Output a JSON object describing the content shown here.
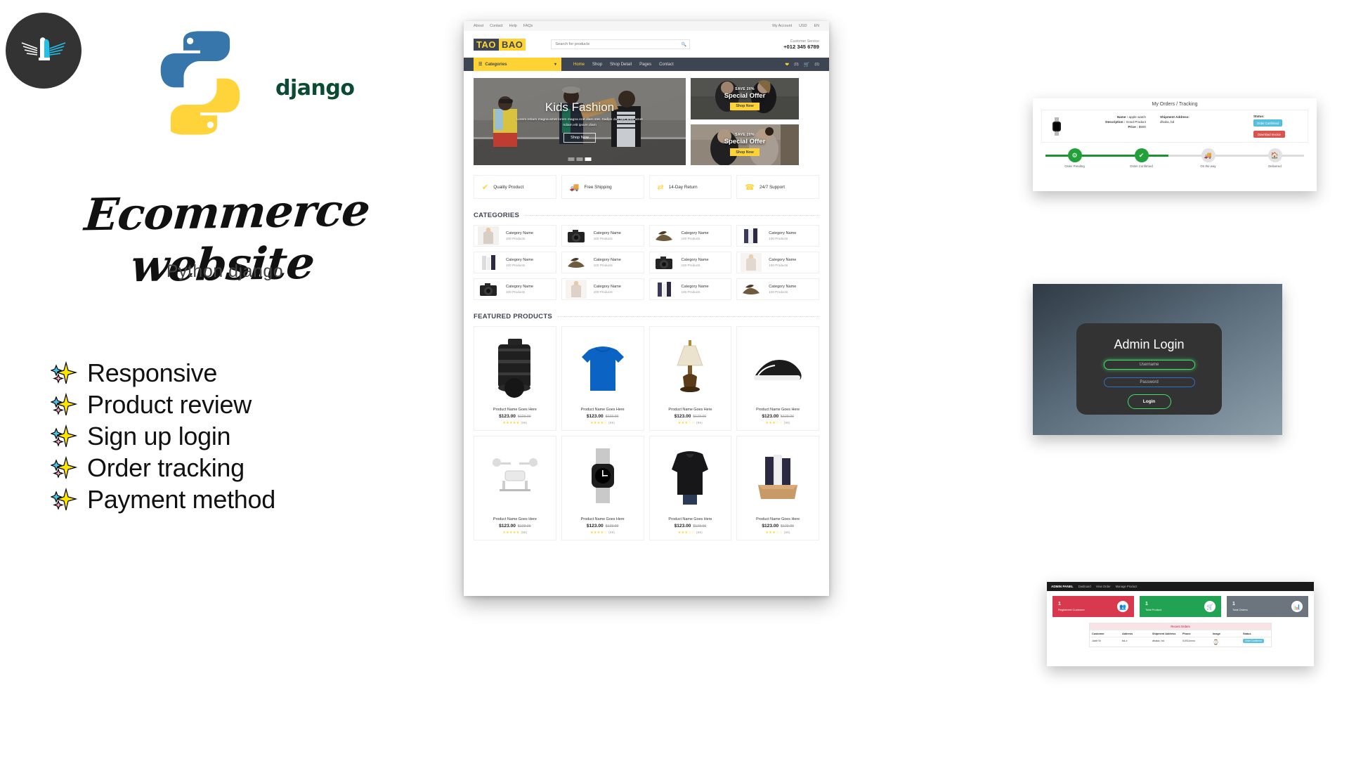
{
  "left": {
    "logo_alt": "bird-wing-logo",
    "python_logo_alt": "python-logo",
    "django_wordmark": "django",
    "headline": "Ecommerce website",
    "subhead": "Python django",
    "features": [
      {
        "icon": "sparkles-icon",
        "label": "Responsive"
      },
      {
        "icon": "sparkles-icon",
        "label": "Product review"
      },
      {
        "icon": "sparkles-icon",
        "label": "Sign up login"
      },
      {
        "icon": "sparkles-icon",
        "label": "Order tracking"
      },
      {
        "icon": "sparkles-icon",
        "label": "Payment method"
      }
    ]
  },
  "storefront": {
    "topbar": {
      "links": [
        "About",
        "Contact",
        "Help",
        "FAQs"
      ],
      "account": "My Account",
      "currency": "USD",
      "language": "EN"
    },
    "header": {
      "logo_first": "TAO",
      "logo_second": "BAO",
      "search_placeholder": "Search for products",
      "customer_service_label": "Customer Service",
      "phone": "+012 345 6789"
    },
    "nav": {
      "categories_label": "Categories",
      "links": [
        "Home",
        "Shop",
        "Shop Detail",
        "Pages",
        "Contact"
      ],
      "wishlist_count": "(0)",
      "cart_count": "(0)"
    },
    "hero": {
      "title": "Kids Fashion",
      "subtitle": "Lorem rebum magna amet lorem magna erat diam stet. Sadips duo stet amet amet ndiam elit ipsum diam",
      "button": "Shop Now",
      "dots": 3,
      "active_dot": 3
    },
    "promos": [
      {
        "save": "SAVE 20%",
        "title": "Special Offer",
        "button": "Shop Now"
      },
      {
        "save": "SAVE 20%",
        "title": "Special Offer",
        "button": "Shop Now"
      }
    ],
    "features": [
      {
        "icon": "check-icon",
        "label": "Quality Product"
      },
      {
        "icon": "truck-icon",
        "label": "Free Shipping"
      },
      {
        "icon": "exchange-icon",
        "label": "14-Day Return"
      },
      {
        "icon": "phone-icon",
        "label": "24/7 Support"
      }
    ],
    "categories_heading": "CATEGORIES",
    "categories": [
      {
        "name": "Category Name",
        "count": "100 Products",
        "thumb": "blouse"
      },
      {
        "name": "Category Name",
        "count": "100 Products",
        "thumb": "camera"
      },
      {
        "name": "Category Name",
        "count": "100 Products",
        "thumb": "shoes"
      },
      {
        "name": "Category Name",
        "count": "100 Products",
        "thumb": "cosmetics"
      },
      {
        "name": "Category Name",
        "count": "100 Products",
        "thumb": "cosmetics"
      },
      {
        "name": "Category Name",
        "count": "100 Products",
        "thumb": "shoes"
      },
      {
        "name": "Category Name",
        "count": "100 Products",
        "thumb": "camera"
      },
      {
        "name": "Category Name",
        "count": "100 Products",
        "thumb": "blouse"
      },
      {
        "name": "Category Name",
        "count": "100 Products",
        "thumb": "camera"
      },
      {
        "name": "Category Name",
        "count": "100 Products",
        "thumb": "blouse"
      },
      {
        "name": "Category Name",
        "count": "100 Products",
        "thumb": "cosmetics"
      },
      {
        "name": "Category Name",
        "count": "100 Products",
        "thumb": "shoes"
      }
    ],
    "featured_heading": "FEATURED PRODUCTS",
    "products": [
      {
        "name": "Product Name Goes Here",
        "price": "$123.00",
        "old_price": "$123.00",
        "stars": 5,
        "reviews": "(99)",
        "thumb": "camera"
      },
      {
        "name": "Product Name Goes Here",
        "price": "$123.00",
        "old_price": "$123.00",
        "stars": 4.5,
        "reviews": "(99)",
        "thumb": "sweater"
      },
      {
        "name": "Product Name Goes Here",
        "price": "$123.00",
        "old_price": "$123.00",
        "stars": 3.5,
        "reviews": "(99)",
        "thumb": "lamp"
      },
      {
        "name": "Product Name Goes Here",
        "price": "$123.00",
        "old_price": "$123.00",
        "stars": 3.5,
        "reviews": "(99)",
        "thumb": "sneaker"
      },
      {
        "name": "Product Name Goes Here",
        "price": "$123.00",
        "old_price": "$123.00",
        "stars": 5,
        "reviews": "(99)",
        "thumb": "drone"
      },
      {
        "name": "Product Name Goes Here",
        "price": "$123.00",
        "old_price": "$123.00",
        "stars": 4.5,
        "reviews": "(99)",
        "thumb": "watch"
      },
      {
        "name": "Product Name Goes Here",
        "price": "$123.00",
        "old_price": "$123.00",
        "stars": 3.5,
        "reviews": "(99)",
        "thumb": "blouse"
      },
      {
        "name": "Product Name Goes Here",
        "price": "$123.00",
        "old_price": "$123.00",
        "stars": 3.5,
        "reviews": "(99)",
        "thumb": "cosmetics"
      }
    ]
  },
  "tracking": {
    "title": "My Orders / Tracking",
    "name_label": "Name :",
    "name_value": "apple watch",
    "desc_label": "Description :",
    "desc_value": "Good Product",
    "price_label": "Price :",
    "price_value": "$500",
    "shipment_label": "Shipment Address:",
    "shipment_value": "dhaka, bd",
    "status_label": "Status:",
    "status_badge": "Order Confirmed",
    "invoice_button": "Download Invoice",
    "steps": [
      {
        "label": "Order Pending",
        "icon": "gear-icon",
        "done": true
      },
      {
        "label": "Order Confirmed",
        "icon": "check-icon",
        "done": true
      },
      {
        "label": "On the way",
        "icon": "truck-icon",
        "done": false
      },
      {
        "label": "Delivered",
        "icon": "home-icon",
        "done": false
      }
    ]
  },
  "login": {
    "title": "Admin Login",
    "username_placeholder": "Username",
    "password_placeholder": "Password",
    "button": "Login"
  },
  "dashboard": {
    "brand": "ADMIN PANEL",
    "nav": [
      "Dasboard",
      "View Order",
      "Manage Product"
    ],
    "cards": [
      {
        "num": "1",
        "caption": "Registered Customer",
        "color": "#d9394f",
        "icon": "users-icon"
      },
      {
        "num": "1",
        "caption": "Total Product",
        "color": "#21a353",
        "icon": "cart-icon"
      },
      {
        "num": "1",
        "caption": "Total Orders",
        "color": "#6c757d",
        "icon": "chart-icon"
      }
    ],
    "table": {
      "title": "Recent Orders",
      "headers": [
        "Customer",
        "Address",
        "Shipment Address",
        "Phone",
        "Image",
        "Status"
      ],
      "rows": [
        {
          "customer": "Jubit Sr",
          "address": "bd-x",
          "shipment": "dhaka, bd",
          "phone": "01911xxxx",
          "image": "watch-icon",
          "status": "Order Confirmed"
        }
      ]
    }
  }
}
